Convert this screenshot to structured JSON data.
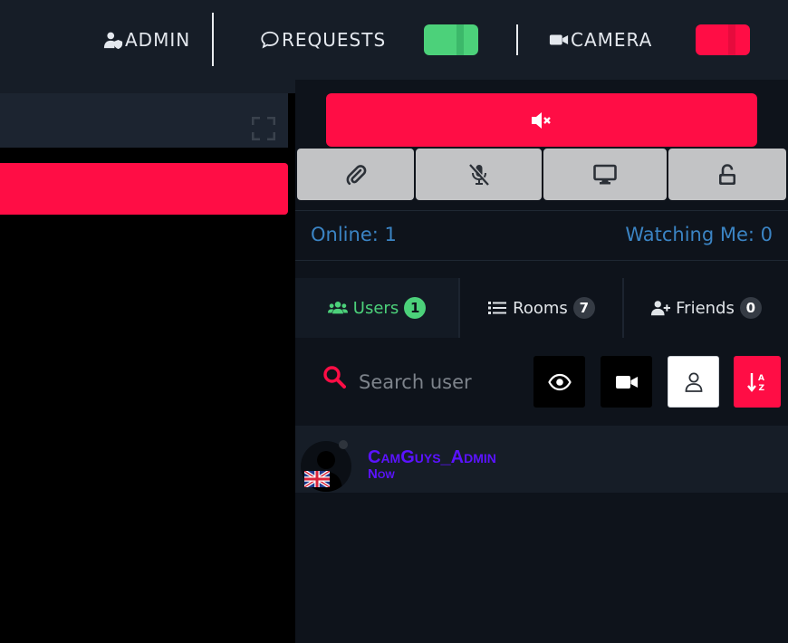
{
  "topbar": {
    "admin_label": "ADMIN",
    "requests_label": "REQUESTS",
    "camera_label": "CAMERA",
    "requests_toggle_color": "#4cd17a",
    "camera_toggle_color": "#ff0d45"
  },
  "colors": {
    "accent_red": "#ff0d45",
    "accent_green": "#4cd17a",
    "stat_blue": "#3b84c4",
    "username_purple": "#5b13ff"
  },
  "toolbar": {
    "mute_icon": "volume-mute-icon",
    "tools": [
      "paperclip-icon",
      "microphone-off-icon",
      "monitor-icon",
      "unlock-icon"
    ]
  },
  "stats": {
    "online": "Online: 1",
    "watching": "Watching Me: 0"
  },
  "tabs": [
    {
      "label": "Users",
      "count": "1",
      "icon": "users-icon",
      "active": true
    },
    {
      "label": "Rooms",
      "count": "7",
      "icon": "list-icon",
      "active": false
    },
    {
      "label": "Friends",
      "count": "0",
      "icon": "user-plus-icon",
      "active": false
    }
  ],
  "search": {
    "placeholder": "Search user",
    "value": ""
  },
  "filters": [
    "eye-icon",
    "video-icon",
    "user-icon",
    "sort-alpha-icon"
  ],
  "users": [
    {
      "name": "CamGuys_Admin",
      "time": "Now",
      "flag": "uk-flag-icon"
    }
  ]
}
